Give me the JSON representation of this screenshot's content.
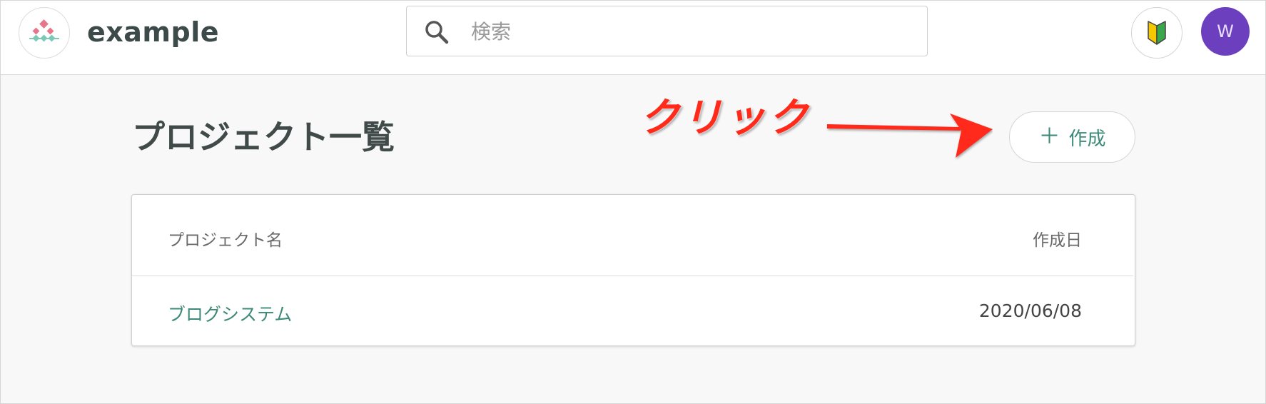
{
  "header": {
    "brand": "example",
    "search": {
      "placeholder": "検索",
      "value": ""
    },
    "avatar_initial": "W"
  },
  "page": {
    "title": "プロジェクト一覧",
    "annotation": "クリック",
    "create_button_label": "作成"
  },
  "table": {
    "columns": [
      "プロジェクト名",
      "作成日"
    ],
    "rows": [
      {
        "name": "ブログシステム",
        "created": "2020/06/08"
      }
    ]
  },
  "colors": {
    "accent": "#3e8a78",
    "avatar": "#6c3fbf",
    "annotation": "#ff2a1a"
  },
  "icons": {
    "logo": "app-logo-icon",
    "search": "search-icon",
    "beginner": "beginner-mark-icon",
    "plus": "plus-icon"
  }
}
